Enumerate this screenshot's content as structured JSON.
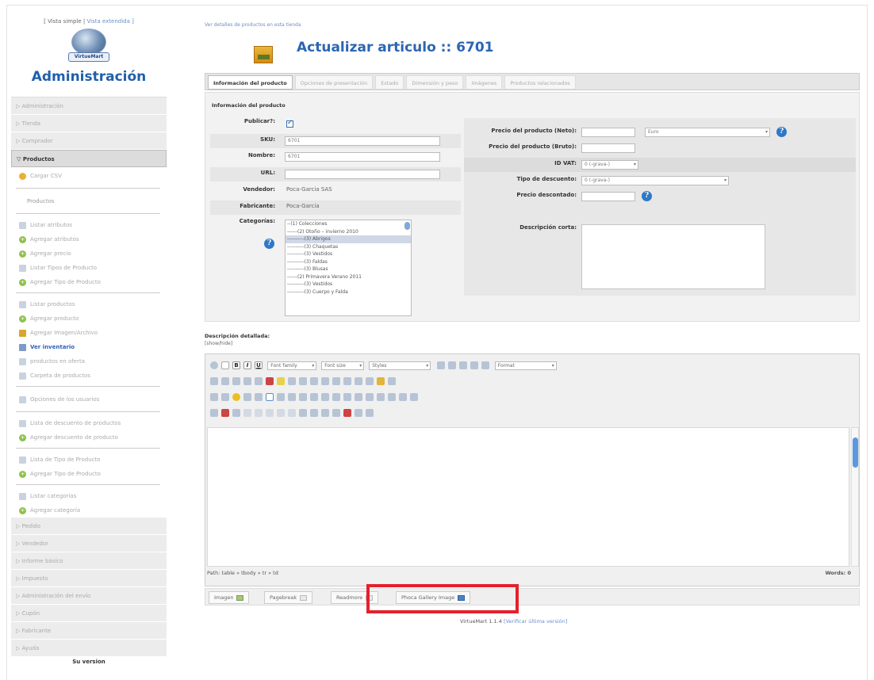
{
  "sidebar": {
    "view_simple": "[ Vista simple",
    "view_extended": "Vista extendida ]",
    "logo_text": "VirtueMart",
    "admin_title": "Administración",
    "headers_top": [
      "Administración",
      "Tienda",
      "Comprador"
    ],
    "active_header": "Productos",
    "upload_csv": "Cargar CSV",
    "products_label": "Productos",
    "group1": [
      "Listar atributos",
      "Agregar atributos",
      "Agregar precio",
      "Listar Tipos de Producto",
      "Agregar Tipo de Producto"
    ],
    "group2": [
      "Listar productos",
      "Agregar producto",
      "Agregar Imagen/Archivo",
      "Ver inventario",
      "productos en oferta",
      "Carpeta de productos"
    ],
    "group3": [
      "Opciones de los usuarios"
    ],
    "group4": [
      "Lista de descuento de productos",
      "Agregar descuento de producto"
    ],
    "group5": [
      "Lista de Tipo de Producto",
      "Agregar Tipo de Producto"
    ],
    "group6": [
      "Listar categorías",
      "Agregar categoría"
    ],
    "headers_bottom": [
      "Pedido",
      "Vendedor",
      "Informe básico",
      "Impuesto",
      "Administración del envío",
      "Cupón",
      "Fabricante",
      "Ayuda"
    ],
    "version_label": "Su version"
  },
  "header": {
    "top_link": "Ver detalles de productos en esta tienda",
    "title": "Actualizar articulo :: 6701"
  },
  "tabs": [
    "Información del producto",
    "Opciones de presentación",
    "Estado",
    "Dimensión y peso",
    "Imágenes",
    "Productos relacionados"
  ],
  "product_info": {
    "section_title": "Información del producto",
    "publish_label": "Publicar?:",
    "sku_label": "SKU:",
    "sku_value": "6701",
    "name_label": "Nombre:",
    "name_value": "6701",
    "url_label": "URL:",
    "url_value": "",
    "vendor_label": "Vendedor:",
    "vendor_value": "Poca-Garcia SAS",
    "manufacturer_label": "Fabricante:",
    "manufacturer_value": "Poca-Garcia",
    "categories_label": "Categorías:",
    "categories": [
      "--(1) Colecciones",
      "------(2) Otoño – invierno 2010",
      "----------(3) Abrigos",
      "----------(3) Chaquetas",
      "----------(3) Vestidos",
      "----------(3) Faldas",
      "----------(3) Blusas",
      "------(2) Primavera Verano 2011",
      "----------(3) Vestidos",
      "----------(3) Cuerpo y Falda"
    ]
  },
  "price": {
    "net_label": "Precio del producto (Neto):",
    "net_value": "",
    "currency": "Euro",
    "gross_label": "Precio del producto (Bruto):",
    "gross_value": "",
    "vat_label": "ID VAT:",
    "vat_value": "0 (-grava-)",
    "discount_type_label": "Tipo de descuento:",
    "discount_type_value": "0 (-grava-)",
    "discounted_label": "Precio descontado:",
    "discounted_value": "",
    "short_desc_label": "Descripción corta:"
  },
  "editor": {
    "label": "Descripción detallada:",
    "show_hide": "[show/hide]",
    "font_family": "Font family",
    "font_size": "Font size",
    "styles": "Styles",
    "format": "Format",
    "path": "Path: table » tbody » tr » td",
    "words": "Words: 0"
  },
  "buttons": {
    "image": "Imagen",
    "pagebreak": "Pagebreak",
    "readmore": "Readmore",
    "phoca": "Phoca Gallery Image"
  },
  "footer": {
    "version": "VirtueMart 1.1.4",
    "check_link": "[Verificar última versión]"
  }
}
